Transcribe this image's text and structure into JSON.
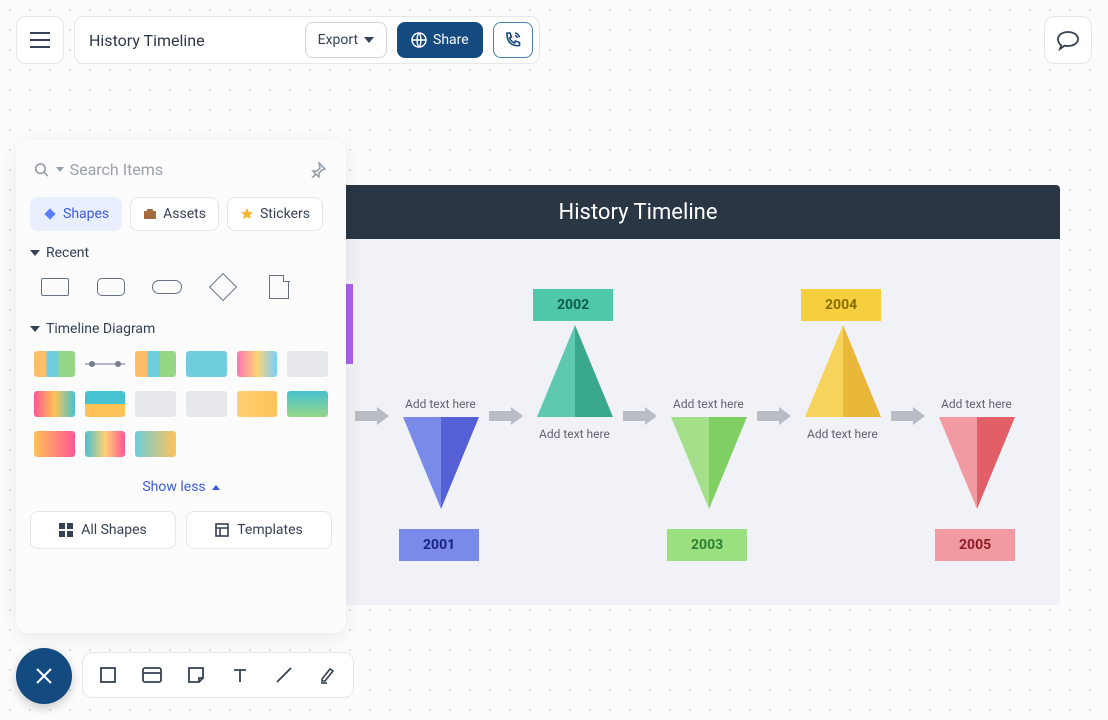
{
  "header": {
    "title": "History Timeline",
    "export_label": "Export",
    "share_label": "Share"
  },
  "panel": {
    "search_placeholder": "Search Items",
    "tabs": {
      "shapes": "Shapes",
      "assets": "Assets",
      "stickers": "Stickers"
    },
    "section_recent": "Recent",
    "section_timeline": "Timeline Diagram",
    "show_less": "Show less",
    "all_shapes": "All Shapes",
    "templates": "Templates"
  },
  "canvas": {
    "title": "History Timeline",
    "items": [
      {
        "year": "2001",
        "text": "Add text here",
        "color_light": "#7a8ae8",
        "color_dark": "#5560d6",
        "dir": "down",
        "year_bg": "#7a8ae8",
        "year_fg": "#1a237e"
      },
      {
        "year": "2002",
        "text": "Add text here",
        "color_light": "#5fc9b0",
        "color_dark": "#3aa88c",
        "dir": "up",
        "year_bg": "#4fc8a8",
        "year_fg": "#0d5c47"
      },
      {
        "year": "2003",
        "text": "Add text here",
        "color_light": "#a4e08a",
        "color_dark": "#7fcf63",
        "dir": "down",
        "year_bg": "#9be07f",
        "year_fg": "#2e7d32"
      },
      {
        "year": "2004",
        "text": "Add text here",
        "color_light": "#f6d35b",
        "color_dark": "#e9b83a",
        "dir": "up",
        "year_bg": "#f6cf3f",
        "year_fg": "#8a6d00"
      },
      {
        "year": "2005",
        "text": "Add text here",
        "color_light": "#f29aa1",
        "color_dark": "#e35f68",
        "dir": "down",
        "year_bg": "#f29aa1",
        "year_fg": "#8a1e24"
      }
    ]
  }
}
